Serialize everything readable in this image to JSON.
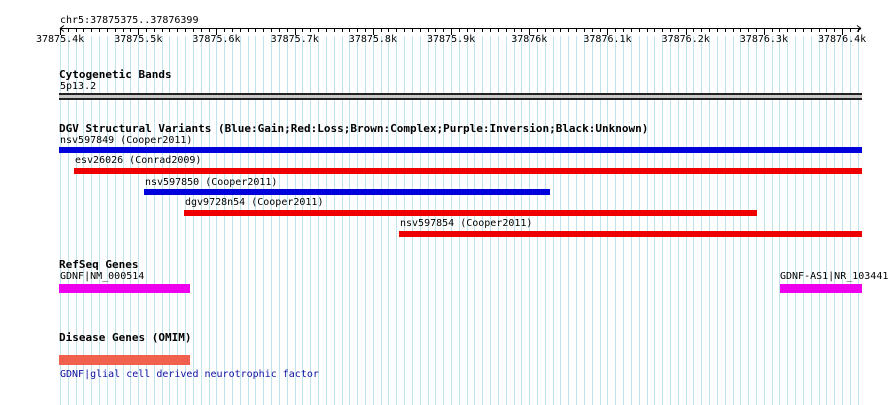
{
  "ruler": {
    "locus": "chr5:37875375..37876399",
    "ticks": [
      "37875.4k",
      "37875.5k",
      "37875.6k",
      "37875.7k",
      "37875.8k",
      "37875.9k",
      "37876k",
      "37876.1k",
      "37876.2k",
      "37876.3k",
      "37876.4k"
    ]
  },
  "cytobands": {
    "title": "Cytogenetic Bands",
    "band": "5p13.2"
  },
  "dgv": {
    "title": "DGV Structural Variants (Blue:Gain;Red:Loss;Brown:Complex;Purple:Inversion;Black:Unknown)",
    "colors": {
      "gain": "#0000dd",
      "loss": "#ee0000"
    },
    "variants": [
      {
        "label": "nsv597849 (Cooper2011)",
        "type": "gain"
      },
      {
        "label": "esv26026 (Conrad2009)",
        "type": "loss"
      },
      {
        "label": "nsv597850 (Cooper2011)",
        "type": "gain"
      },
      {
        "label": "dgv9728n54 (Cooper2011)",
        "type": "loss"
      },
      {
        "label": "nsv597854 (Cooper2011)",
        "type": "loss"
      }
    ]
  },
  "refseq": {
    "title": "RefSeq Genes",
    "color": "#ee00ee",
    "genes": [
      {
        "label": "GDNF|NM_000514"
      },
      {
        "label": "GDNF-AS1|NR_103441"
      }
    ]
  },
  "disease": {
    "title": "Disease Genes (OMIM)",
    "color": "#f0604c",
    "gene_label": "GDNF|glial cell derived neurotrophic factor"
  }
}
